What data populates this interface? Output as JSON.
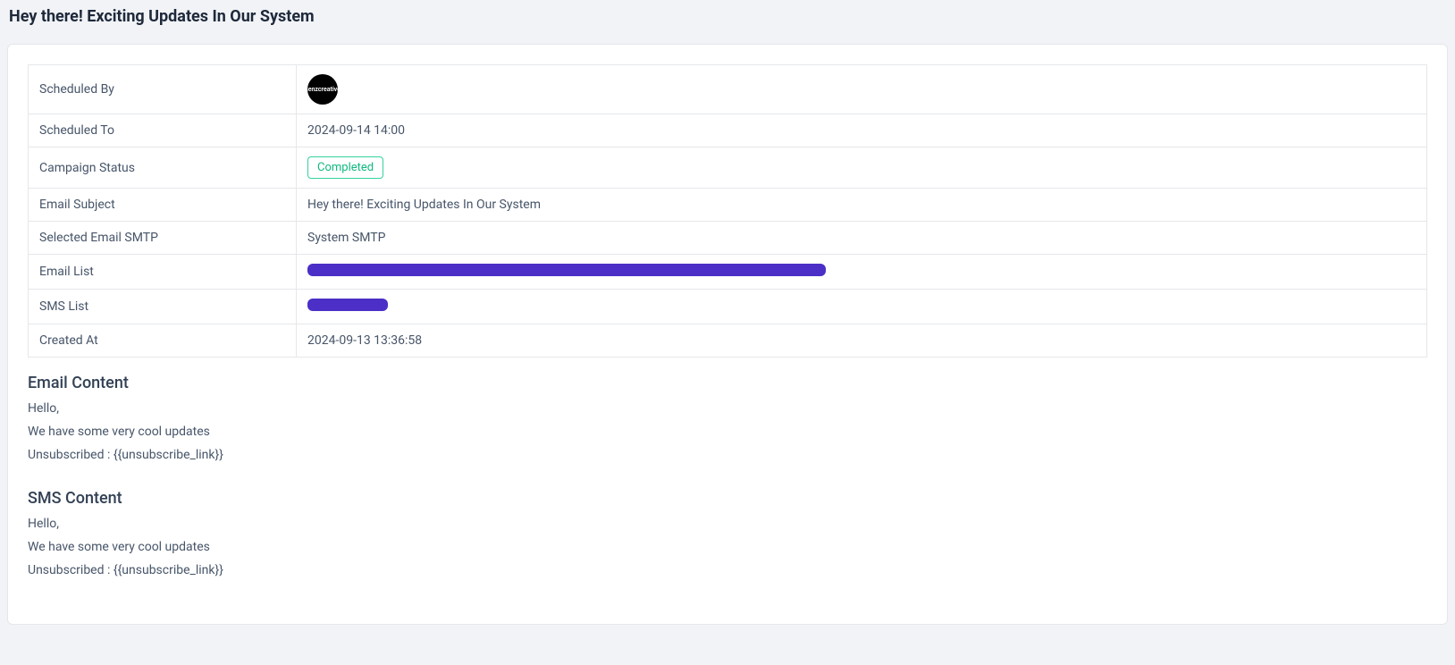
{
  "page": {
    "title": "Hey there! Exciting Updates In Our System"
  },
  "labels": {
    "scheduled_by": "Scheduled By",
    "scheduled_to": "Scheduled To",
    "campaign_status": "Campaign Status",
    "email_subject": "Email Subject",
    "selected_smtp": "Selected Email SMTP",
    "email_list": "Email List",
    "sms_list": "SMS List",
    "created_at": "Created At"
  },
  "values": {
    "avatar_text": "senzcreative",
    "scheduled_to": "2024-09-14 14:00",
    "campaign_status": "Completed",
    "email_subject": "Hey there! Exciting Updates In Our System",
    "selected_smtp": "System SMTP",
    "created_at": "2024-09-13 13:36:58"
  },
  "sections": {
    "email_heading": "Email Content",
    "sms_heading": "SMS Content"
  },
  "email_content": {
    "line1": "Hello,",
    "line2": "We have some very cool updates",
    "line3": "Unsubscribed : {{unsubscribe_link}}"
  },
  "sms_content": {
    "line1": "Hello,",
    "line2": "We have some very cool updates",
    "line3": "Unsubscribed : {{unsubscribe_link}}"
  }
}
